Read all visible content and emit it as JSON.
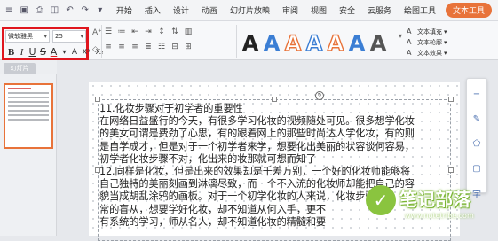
{
  "menu": {
    "quick_icons": [
      "app-menu-icon",
      "save-icon",
      "print-icon",
      "preview-icon",
      "undo-icon",
      "redo-icon",
      "dropdown-icon"
    ],
    "items": [
      "开始",
      "插入",
      "设计",
      "动画",
      "幻灯片放映",
      "审阅",
      "视图",
      "安全",
      "云服务",
      "绘图工具",
      "文本工具"
    ],
    "active": "文本工具"
  },
  "ribbon": {
    "font_name": "微软雅黑",
    "font_size": "25",
    "format_buttons": [
      "B",
      "I",
      "U",
      "S",
      "A",
      "A",
      "X²",
      "X₂"
    ],
    "styles": [
      {
        "letter": "A",
        "fill": "#222222",
        "stroke": "none"
      },
      {
        "letter": "A",
        "fill": "#3b7ed4",
        "stroke": "none"
      },
      {
        "letter": "A",
        "fill": "#ffffff",
        "stroke": "#e8733a"
      },
      {
        "letter": "A",
        "fill": "#ffffff",
        "stroke": "#3b7ed4"
      },
      {
        "letter": "A",
        "fill": "#ffffff",
        "stroke": "#e8733a"
      },
      {
        "letter": "A",
        "fill": "#3b7ed4",
        "stroke": "none"
      },
      {
        "letter": "A",
        "fill": "#555555",
        "stroke": "none"
      }
    ],
    "right": {
      "fill_label": "文本填充",
      "outline_label": "文本轮廓",
      "effects_label": "文本效果"
    }
  },
  "left_panel": {
    "tab_label": "幻灯片"
  },
  "slide_text": [
    "11.化妆步骤对于初学者的重要性",
    "在网络日益盛行的今天，有很多学习化妆的视频随处可见。很多想学化妆",
    "的美女可谓是费劲了心思，有的跟着网上的那些时尚达人学化妆，有的则",
    "是自学成才，但是对于一个初学者来学，想要化出美丽的状容谈何容易，",
    "初学者化妆步骤不对，化出来的妆那就可想而知了",
    "12.同样是化妆，但是出来的效果却是千差万别，一个好的化妆师能够将",
    "自己独特的美丽刻画到淋漓尽致，而一个不入流的化妆师却能把自己的容",
    "貌当成胡乱涂鸦的画板。对于一个初学化妆的人来说，化妆步骤",
    "常的盲从，想要学好化妆，却不知道从何入手，更不",
    "有系统的学习，师从名人，却不知道化妆的精髓和要"
  ],
  "watermark": {
    "title": "笔记部落",
    "url": "www.notetribe.com",
    "color": "#7bb534"
  }
}
